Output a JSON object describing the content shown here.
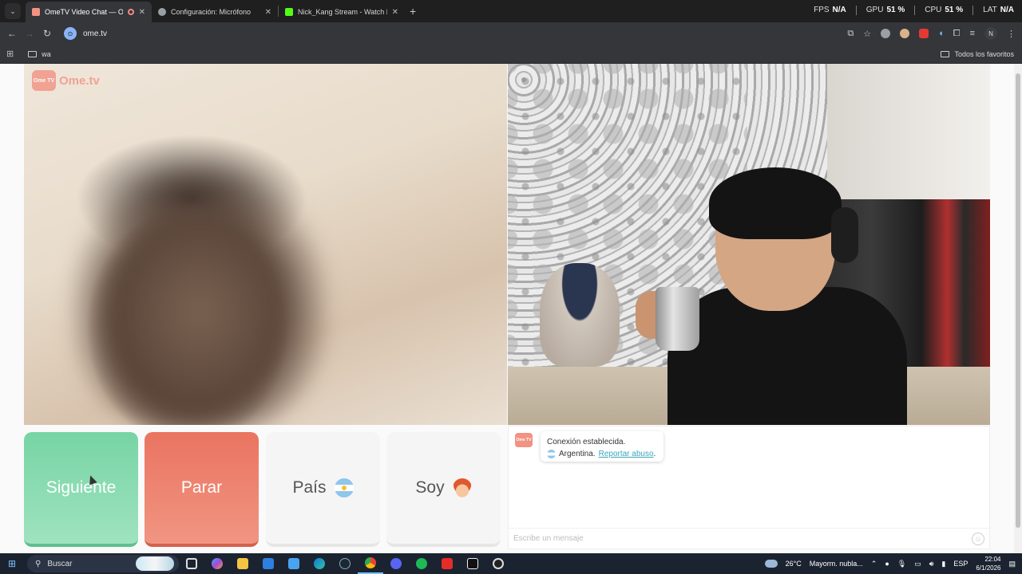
{
  "browser": {
    "tabs": [
      {
        "title": "OmeTV Video Chat — Ome",
        "active": true,
        "favicon_color": "#f29282"
      },
      {
        "title": "Configuración: Micrófono",
        "active": false,
        "favicon_color": "#9aa0a6"
      },
      {
        "title": "Nick_Kang Stream - Watch Live",
        "active": false,
        "favicon_color": "#53fc18"
      }
    ],
    "new_tab": "+",
    "perf": {
      "fps_label": "FPS",
      "fps_value": "N/A",
      "gpu_label": "GPU",
      "gpu_value": "51 %",
      "cpu_label": "CPU",
      "cpu_value": "51 %",
      "lat_label": "LAT",
      "lat_value": "N/A"
    },
    "url": "ome.tv",
    "profile_initial": "N",
    "bookmarks": {
      "folder": "wa",
      "all": "Todos los favoritos"
    }
  },
  "page": {
    "logo_text": "Ome.tv",
    "logo_mark": "Ome TV",
    "buttons": {
      "next": "Siguiente",
      "stop": "Parar",
      "country": "País",
      "gender": "Soy"
    },
    "chat": {
      "bot_mark": "Ome TV",
      "status": "Conexión establecida.",
      "country": "Argentina.",
      "report_link": "Reportar abuso",
      "report_suffix": ".",
      "input_placeholder": "Escribe un mensaje"
    },
    "colors": {
      "next": "#77d4a4",
      "stop": "#ea7460",
      "brand": "#f29282",
      "link": "#3aa6b9"
    }
  },
  "taskbar": {
    "search_placeholder": "Buscar",
    "weather": "26°C",
    "weather_desc": "Mayorm. nubla...",
    "language": "ESP",
    "time": "22:04",
    "date": "6/1/2026"
  }
}
